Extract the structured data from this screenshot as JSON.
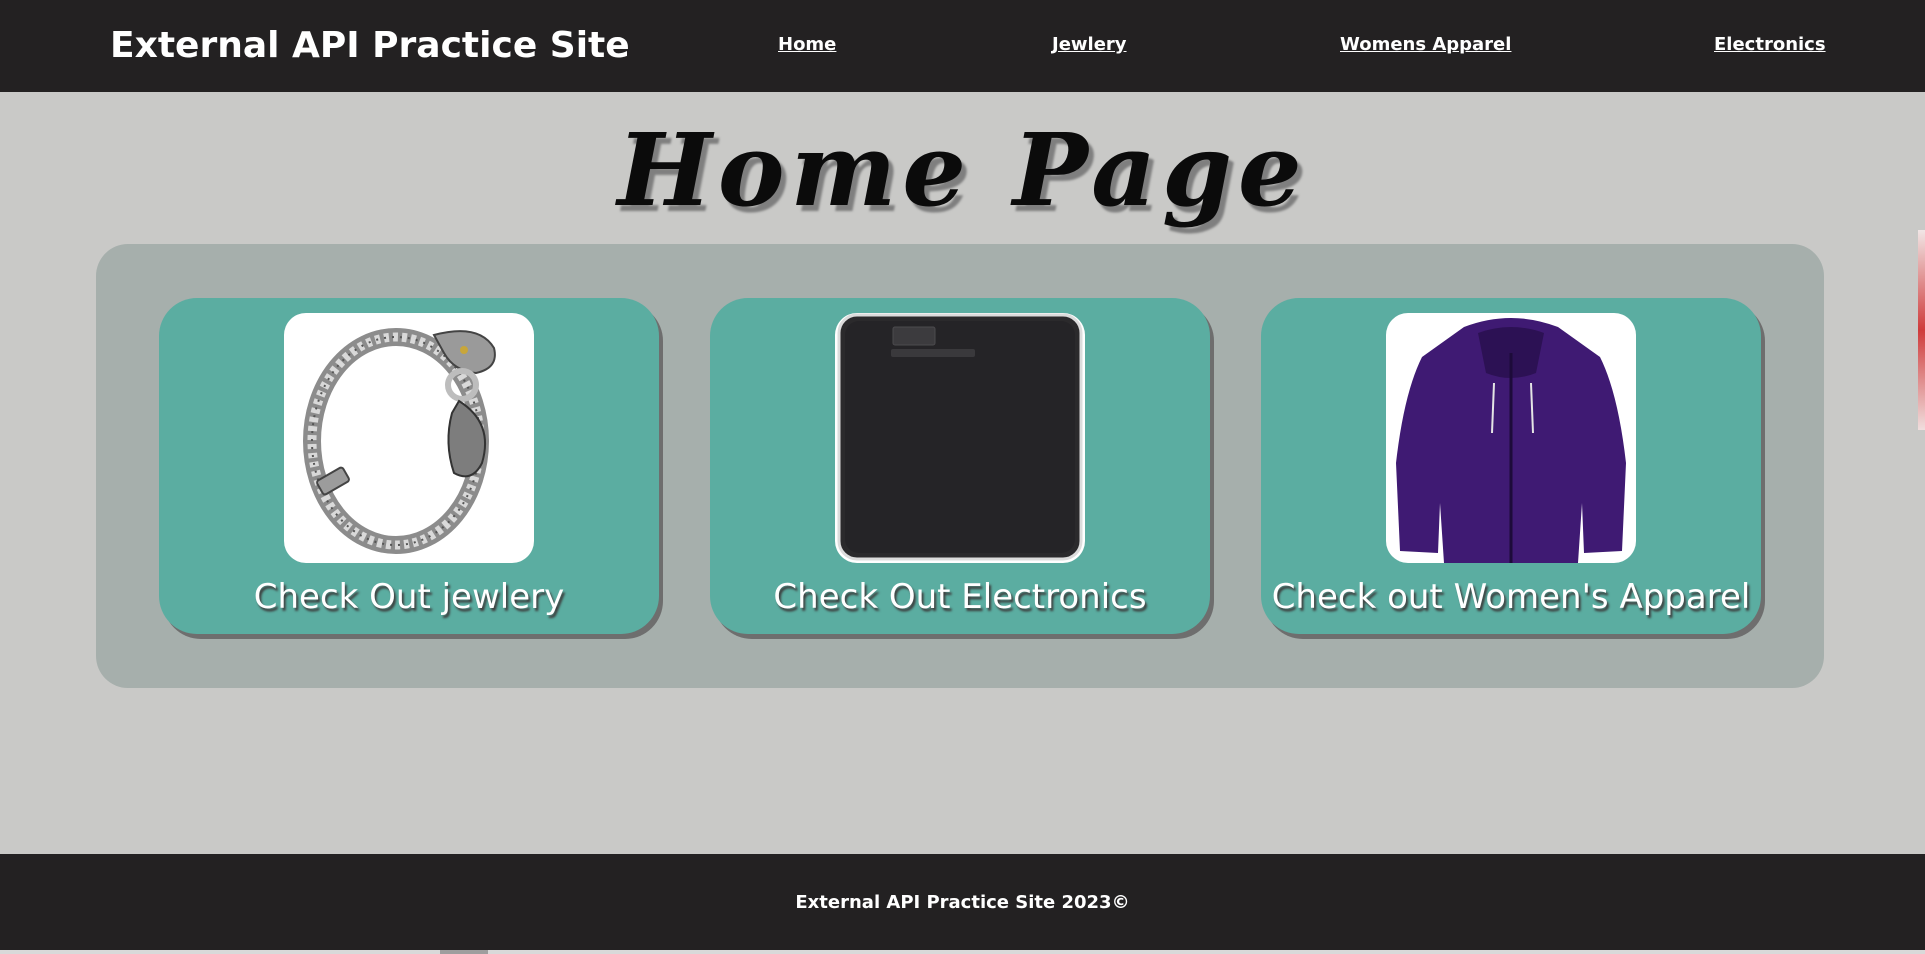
{
  "header": {
    "title": "External API Practice Site",
    "nav": [
      "Home",
      "Jewlery",
      "Womens Apparel",
      "Electronics"
    ]
  },
  "main": {
    "heading": "Home Page",
    "cards": [
      {
        "label": "Check Out jewlery",
        "image": "bracelet-icon"
      },
      {
        "label": "Check Out Electronics",
        "image": "hard-drive-icon"
      },
      {
        "label": "Check out Women's Apparel",
        "image": "jacket-icon"
      }
    ]
  },
  "footer": {
    "text": "External API Practice Site 2023©"
  },
  "colors": {
    "bar": "#232122",
    "background": "#c9c9c7",
    "panel": "#a6afac",
    "card": "#5bada1"
  }
}
